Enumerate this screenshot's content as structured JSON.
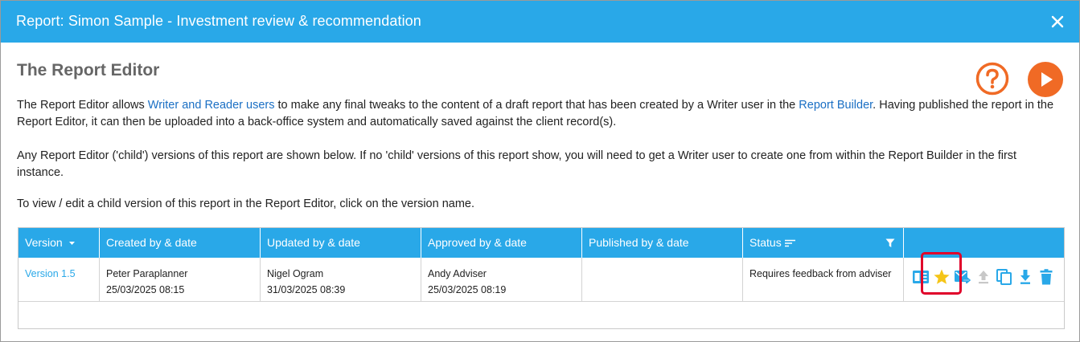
{
  "window": {
    "title": "Report: Simon Sample - Investment review & recommendation"
  },
  "editor": {
    "heading": "The Report Editor",
    "p1_a": "The Report Editor allows ",
    "p1_link1": "Writer and Reader users",
    "p1_b": " to make any final tweaks to the content of a draft report that has been created by a Writer user in the ",
    "p1_link2": "Report Builder",
    "p1_c": ". Having published the report in the Report Editor, it can then be uploaded into a back-office system and automatically saved against the client record(s).",
    "p2": "Any Report Editor ('child') versions of this report are shown below. If no 'child' versions of this report show, you will need to get a Writer user to create one from within the Report Builder in the first instance.",
    "p3": "To view / edit a child version of this report in the Report Editor, click on the version name."
  },
  "table": {
    "headers": {
      "version": "Version",
      "created": "Created by & date",
      "updated": "Updated by & date",
      "approved": "Approved by & date",
      "published": "Published by & date",
      "status": "Status"
    },
    "rows": [
      {
        "version": "Version 1.5",
        "created_by": "Peter Paraplanner",
        "created_date": "25/03/2025 08:15",
        "updated_by": "Nigel Ogram",
        "updated_date": "31/03/2025 08:39",
        "approved_by": "Andy Adviser",
        "approved_date": "25/03/2025 08:19",
        "published_by": "",
        "published_date": "",
        "status": "Requires feedback from adviser"
      }
    ]
  },
  "icons": {
    "accent": "#29a8e8",
    "orange": "#f06a25",
    "star": "#f5c518",
    "disabled": "#c8c8c8",
    "highlight": "#e0002a"
  }
}
